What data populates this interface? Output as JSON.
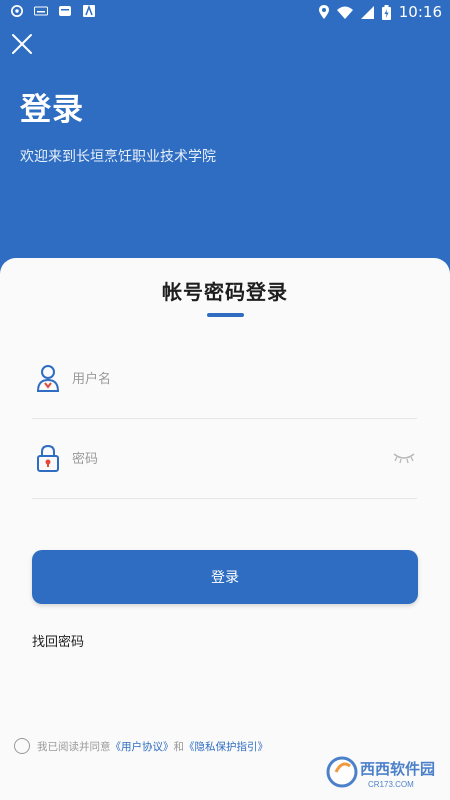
{
  "status_bar": {
    "time": "10:16",
    "icons": [
      "app-icon",
      "keyboard-icon",
      "app-icon",
      "app-icon",
      "location-icon",
      "wifi-icon",
      "signal-icon",
      "battery-icon"
    ]
  },
  "header": {
    "title": "登录",
    "welcome": "欢迎来到长垣烹饪职业技术学院",
    "background": "#2e6dc2"
  },
  "login_card": {
    "title": "帐号密码登录",
    "username": {
      "placeholder": "用户名",
      "value": ""
    },
    "password": {
      "placeholder": "密码",
      "value": ""
    },
    "submit_label": "登录",
    "forgot_label": "找回密码"
  },
  "agreement": {
    "prefix": "我已阅读并同意",
    "user_agreement": "《用户协议》",
    "and": "和",
    "privacy_guide": "《隐私保护指引》"
  },
  "watermark": {
    "name": "西西软件园",
    "domain": "CR173.COM"
  },
  "colors": {
    "accent": "#2e6dc2",
    "card_bg": "#fafafa"
  }
}
